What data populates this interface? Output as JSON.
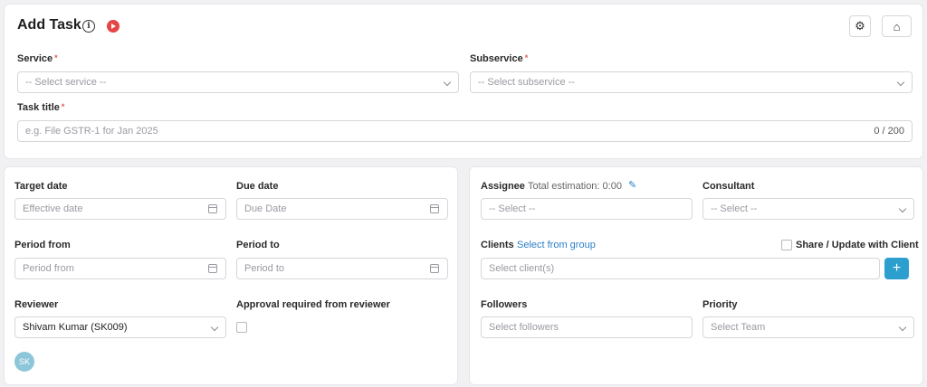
{
  "header": {
    "title": "Add Task",
    "info_icon": "info-icon",
    "play_icon": "play-icon",
    "settings_icon": "gear-icon",
    "home_icon": "home-icon"
  },
  "service": {
    "label": "Service",
    "placeholder": "-- Select service --"
  },
  "subservice": {
    "label": "Subservice",
    "placeholder": "-- Select subservice --"
  },
  "task_title": {
    "label": "Task title",
    "placeholder": "e.g. File GSTR-1 for Jan 2025",
    "counter": "0 / 200"
  },
  "left": {
    "target_date": {
      "label": "Target date",
      "placeholder": "Effective date"
    },
    "due_date": {
      "label": "Due date",
      "placeholder": "Due Date"
    },
    "period_from": {
      "label": "Period from",
      "placeholder": "Period from"
    },
    "period_to": {
      "label": "Period to",
      "placeholder": "Period to"
    },
    "reviewer": {
      "label": "Reviewer",
      "value": "Shivam Kumar (SK009)"
    },
    "approval": {
      "label": "Approval required from reviewer",
      "checked": false
    },
    "avatar_initials": "SK"
  },
  "right": {
    "assignee": {
      "label": "Assignee",
      "estimation": "Total estimation: 0:00",
      "placeholder": "-- Select --"
    },
    "consultant": {
      "label": "Consultant",
      "placeholder": "-- Select --"
    },
    "clients": {
      "label": "Clients",
      "link": "Select from group",
      "placeholder": "Select client(s)"
    },
    "share": {
      "label": "Share / Update with Client",
      "checked": false
    },
    "followers": {
      "label": "Followers",
      "placeholder": "Select followers"
    },
    "priority": {
      "label": "Priority",
      "placeholder": "Select Team"
    }
  },
  "colors": {
    "accent": "#2d9fcf",
    "link": "#2b7fc8",
    "required": "#e25a5a",
    "play": "#e64545"
  }
}
